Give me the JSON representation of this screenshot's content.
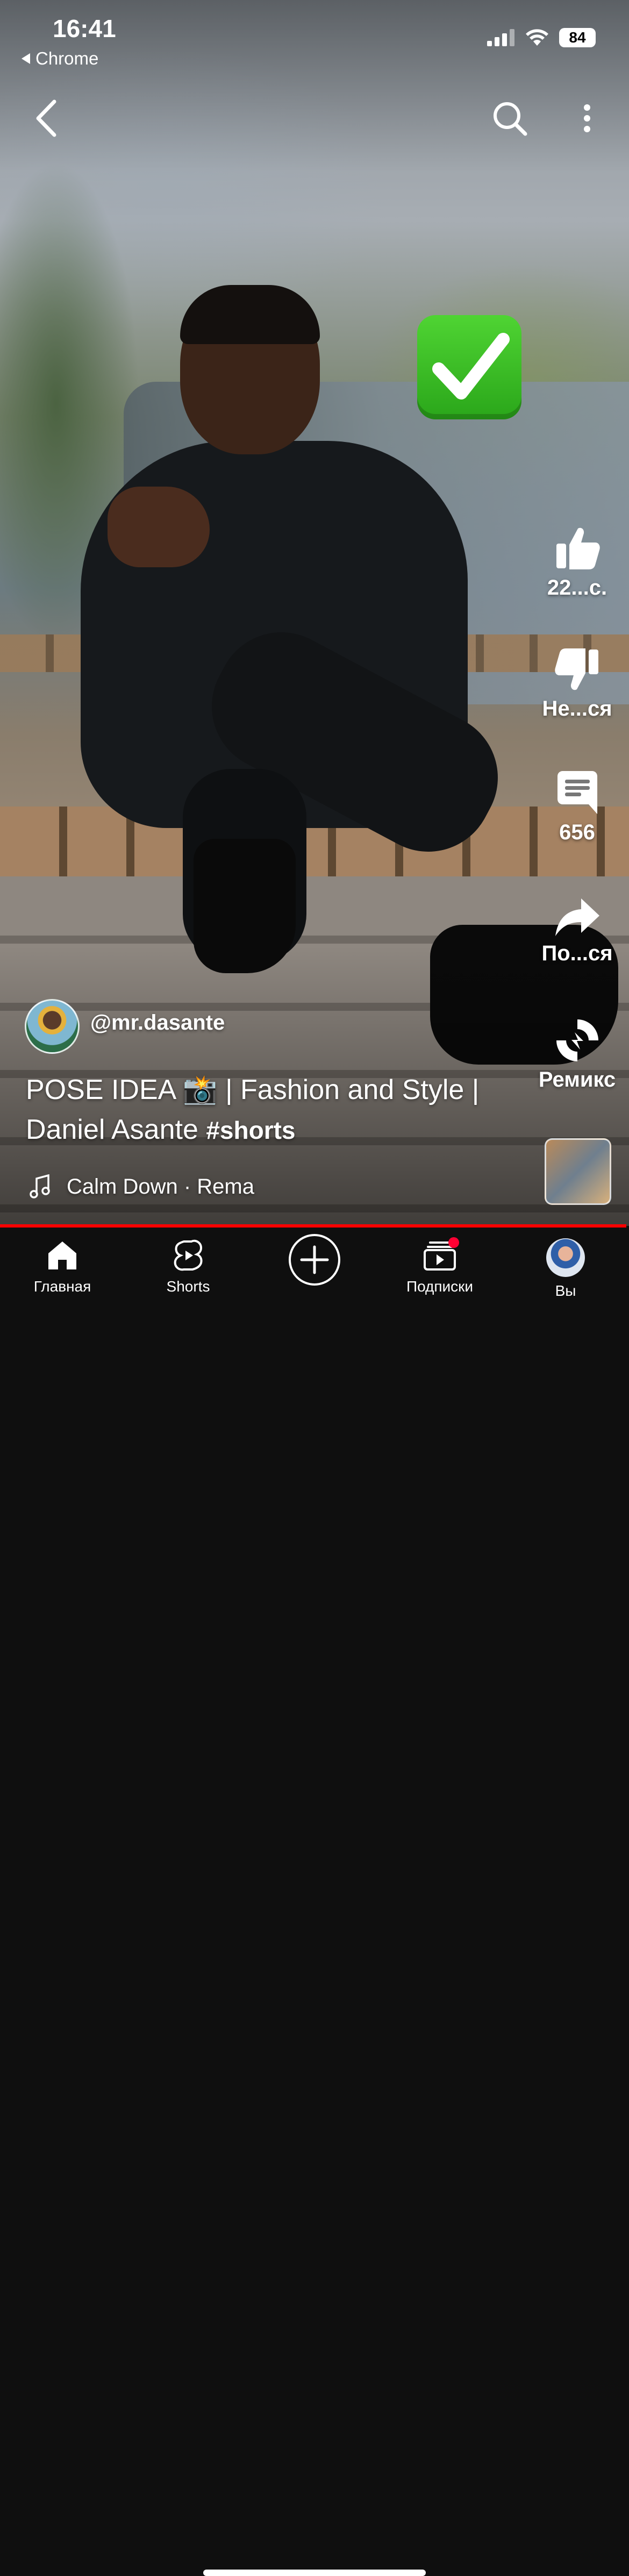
{
  "status_bar": {
    "time": "16:41",
    "back_app_label": "Chrome",
    "battery": "84"
  },
  "top_bar": {
    "back_icon": "chevron-left-icon",
    "search_icon": "search-icon",
    "more_icon": "more-vert-icon"
  },
  "video": {
    "overlay_emoji": "✅"
  },
  "actions": {
    "like_count": "22...с.",
    "dislike_label": "Не...ся",
    "comments_count": "656",
    "share_label": "По...ся",
    "remix_label": "Ремикс"
  },
  "channel": {
    "handle": "@mr.dasante"
  },
  "title": {
    "text": "POSE IDEA 📸 | Fashion and Style | Daniel Asante",
    "hashtag": "#shorts"
  },
  "music": {
    "track": "Calm Down · Rema"
  },
  "colors": {
    "progress": "#ff0000",
    "nav_background": "#0f0f0f",
    "notification_dot": "#ff0033"
  },
  "nav": {
    "items": [
      {
        "label": "Главная",
        "icon": "home-icon"
      },
      {
        "label": "Shorts",
        "icon": "shorts-icon"
      },
      {
        "label": "",
        "icon": "create-plus-icon"
      },
      {
        "label": "Подписки",
        "icon": "subscriptions-icon"
      },
      {
        "label": "Вы",
        "icon": "avatar"
      }
    ]
  }
}
